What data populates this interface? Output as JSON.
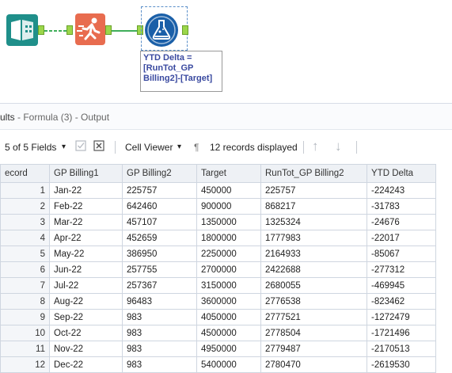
{
  "workflow": {
    "annotation": "YTD Delta =\n[RunTot_GP\nBilling2]-[Target]"
  },
  "results": {
    "title_prefix": "ults",
    "title_sub": " - Formula (3) - Output"
  },
  "toolbar": {
    "fields_label": "5 of 5 Fields",
    "dropdown_glyph": "▾",
    "cell_viewer_label": "Cell Viewer",
    "pilcrow": "¶",
    "records_label": "12 records displayed",
    "up_arrow": "↑",
    "down_arrow": "↓"
  },
  "grid": {
    "columns": [
      "ecord",
      "GP Billing1",
      "GP Billing2",
      "Target",
      "RunTot_GP Billing2",
      "YTD Delta"
    ],
    "rows": [
      [
        "1",
        "Jan-22",
        "225757",
        "450000",
        "225757",
        "-224243"
      ],
      [
        "2",
        "Feb-22",
        "642460",
        "900000",
        "868217",
        "-31783"
      ],
      [
        "3",
        "Mar-22",
        "457107",
        "1350000",
        "1325324",
        "-24676"
      ],
      [
        "4",
        "Apr-22",
        "452659",
        "1800000",
        "1777983",
        "-22017"
      ],
      [
        "5",
        "May-22",
        "386950",
        "2250000",
        "2164933",
        "-85067"
      ],
      [
        "6",
        "Jun-22",
        "257755",
        "2700000",
        "2422688",
        "-277312"
      ],
      [
        "7",
        "Jul-22",
        "257367",
        "3150000",
        "2680055",
        "-469945"
      ],
      [
        "8",
        "Aug-22",
        "96483",
        "3600000",
        "2776538",
        "-823462"
      ],
      [
        "9",
        "Sep-22",
        "983",
        "4050000",
        "2777521",
        "-1272479"
      ],
      [
        "10",
        "Oct-22",
        "983",
        "4500000",
        "2778504",
        "-1721496"
      ],
      [
        "11",
        "Nov-22",
        "983",
        "4950000",
        "2779487",
        "-2170513"
      ],
      [
        "12",
        "Dec-22",
        "983",
        "5400000",
        "2780470",
        "-2619530"
      ]
    ]
  }
}
